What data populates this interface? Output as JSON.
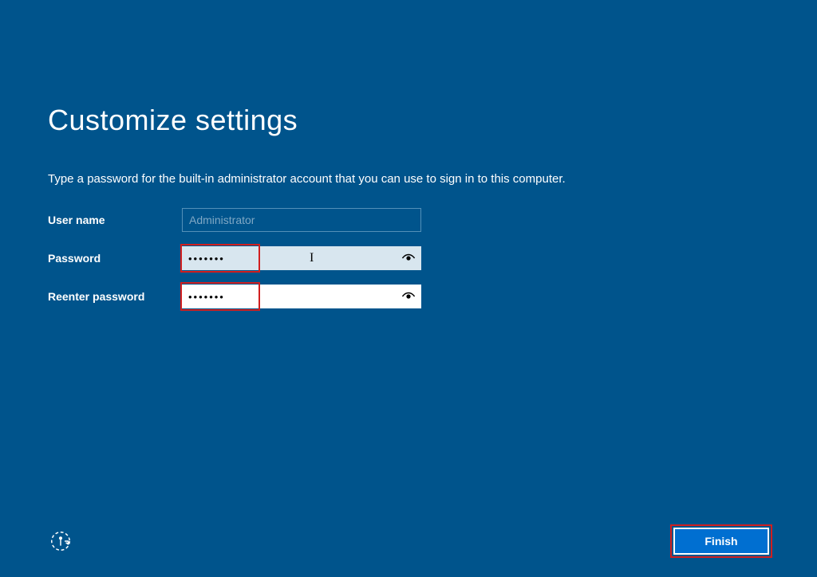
{
  "page": {
    "title": "Customize settings",
    "instruction": "Type a password for the built-in administrator account that you can use to sign in to this computer."
  },
  "form": {
    "username_label": "User name",
    "username_value": "Administrator",
    "password_label": "Password",
    "password_value": "•••••••",
    "reenter_label": "Reenter password",
    "reenter_value": "•••••••"
  },
  "buttons": {
    "finish": "Finish"
  },
  "icons": {
    "reveal": "password-reveal-icon",
    "ease": "ease-of-access-icon"
  },
  "colors": {
    "background": "#00548c",
    "highlight": "#d11f1f",
    "button": "#006fd1"
  }
}
